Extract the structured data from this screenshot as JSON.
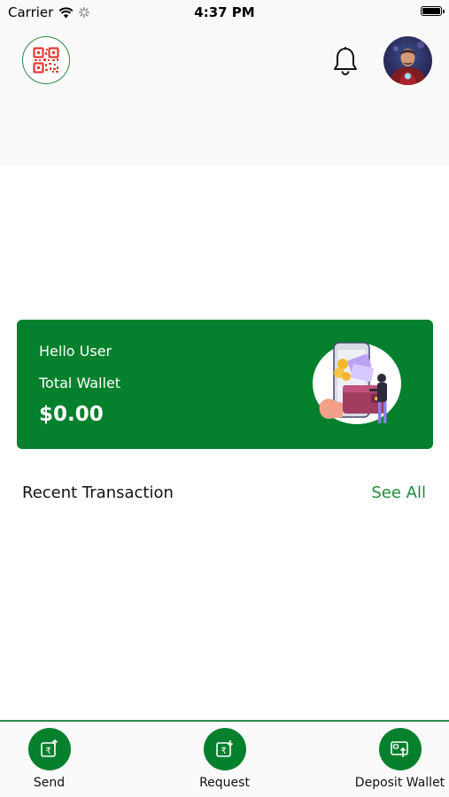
{
  "status_bar": {
    "carrier": "Carrier",
    "time": "4:37 PM",
    "icons": [
      "wifi-icon",
      "activity-spinner-icon",
      "battery-icon"
    ]
  },
  "header": {
    "qr_icon": "qr-code-icon",
    "bell_icon": "bell-icon",
    "avatar_icon": "user-avatar"
  },
  "wallet_card": {
    "greeting": "Hello User",
    "label": "Total Wallet",
    "amount": "$0.00",
    "illustration": "wallet-illustration"
  },
  "transactions": {
    "title": "Recent Transaction",
    "see_all_label": "See All"
  },
  "tab_bar": {
    "items": [
      {
        "label": "Send",
        "icon": "send-money-icon"
      },
      {
        "label": "Request",
        "icon": "request-money-icon"
      },
      {
        "label": "Deposit Wallet",
        "icon": "deposit-wallet-icon"
      }
    ]
  },
  "colors": {
    "primary_green": "#05802d",
    "accent_green": "#1e8a3c",
    "qr_red": "#e53935",
    "header_bg": "#f9f9f9"
  }
}
